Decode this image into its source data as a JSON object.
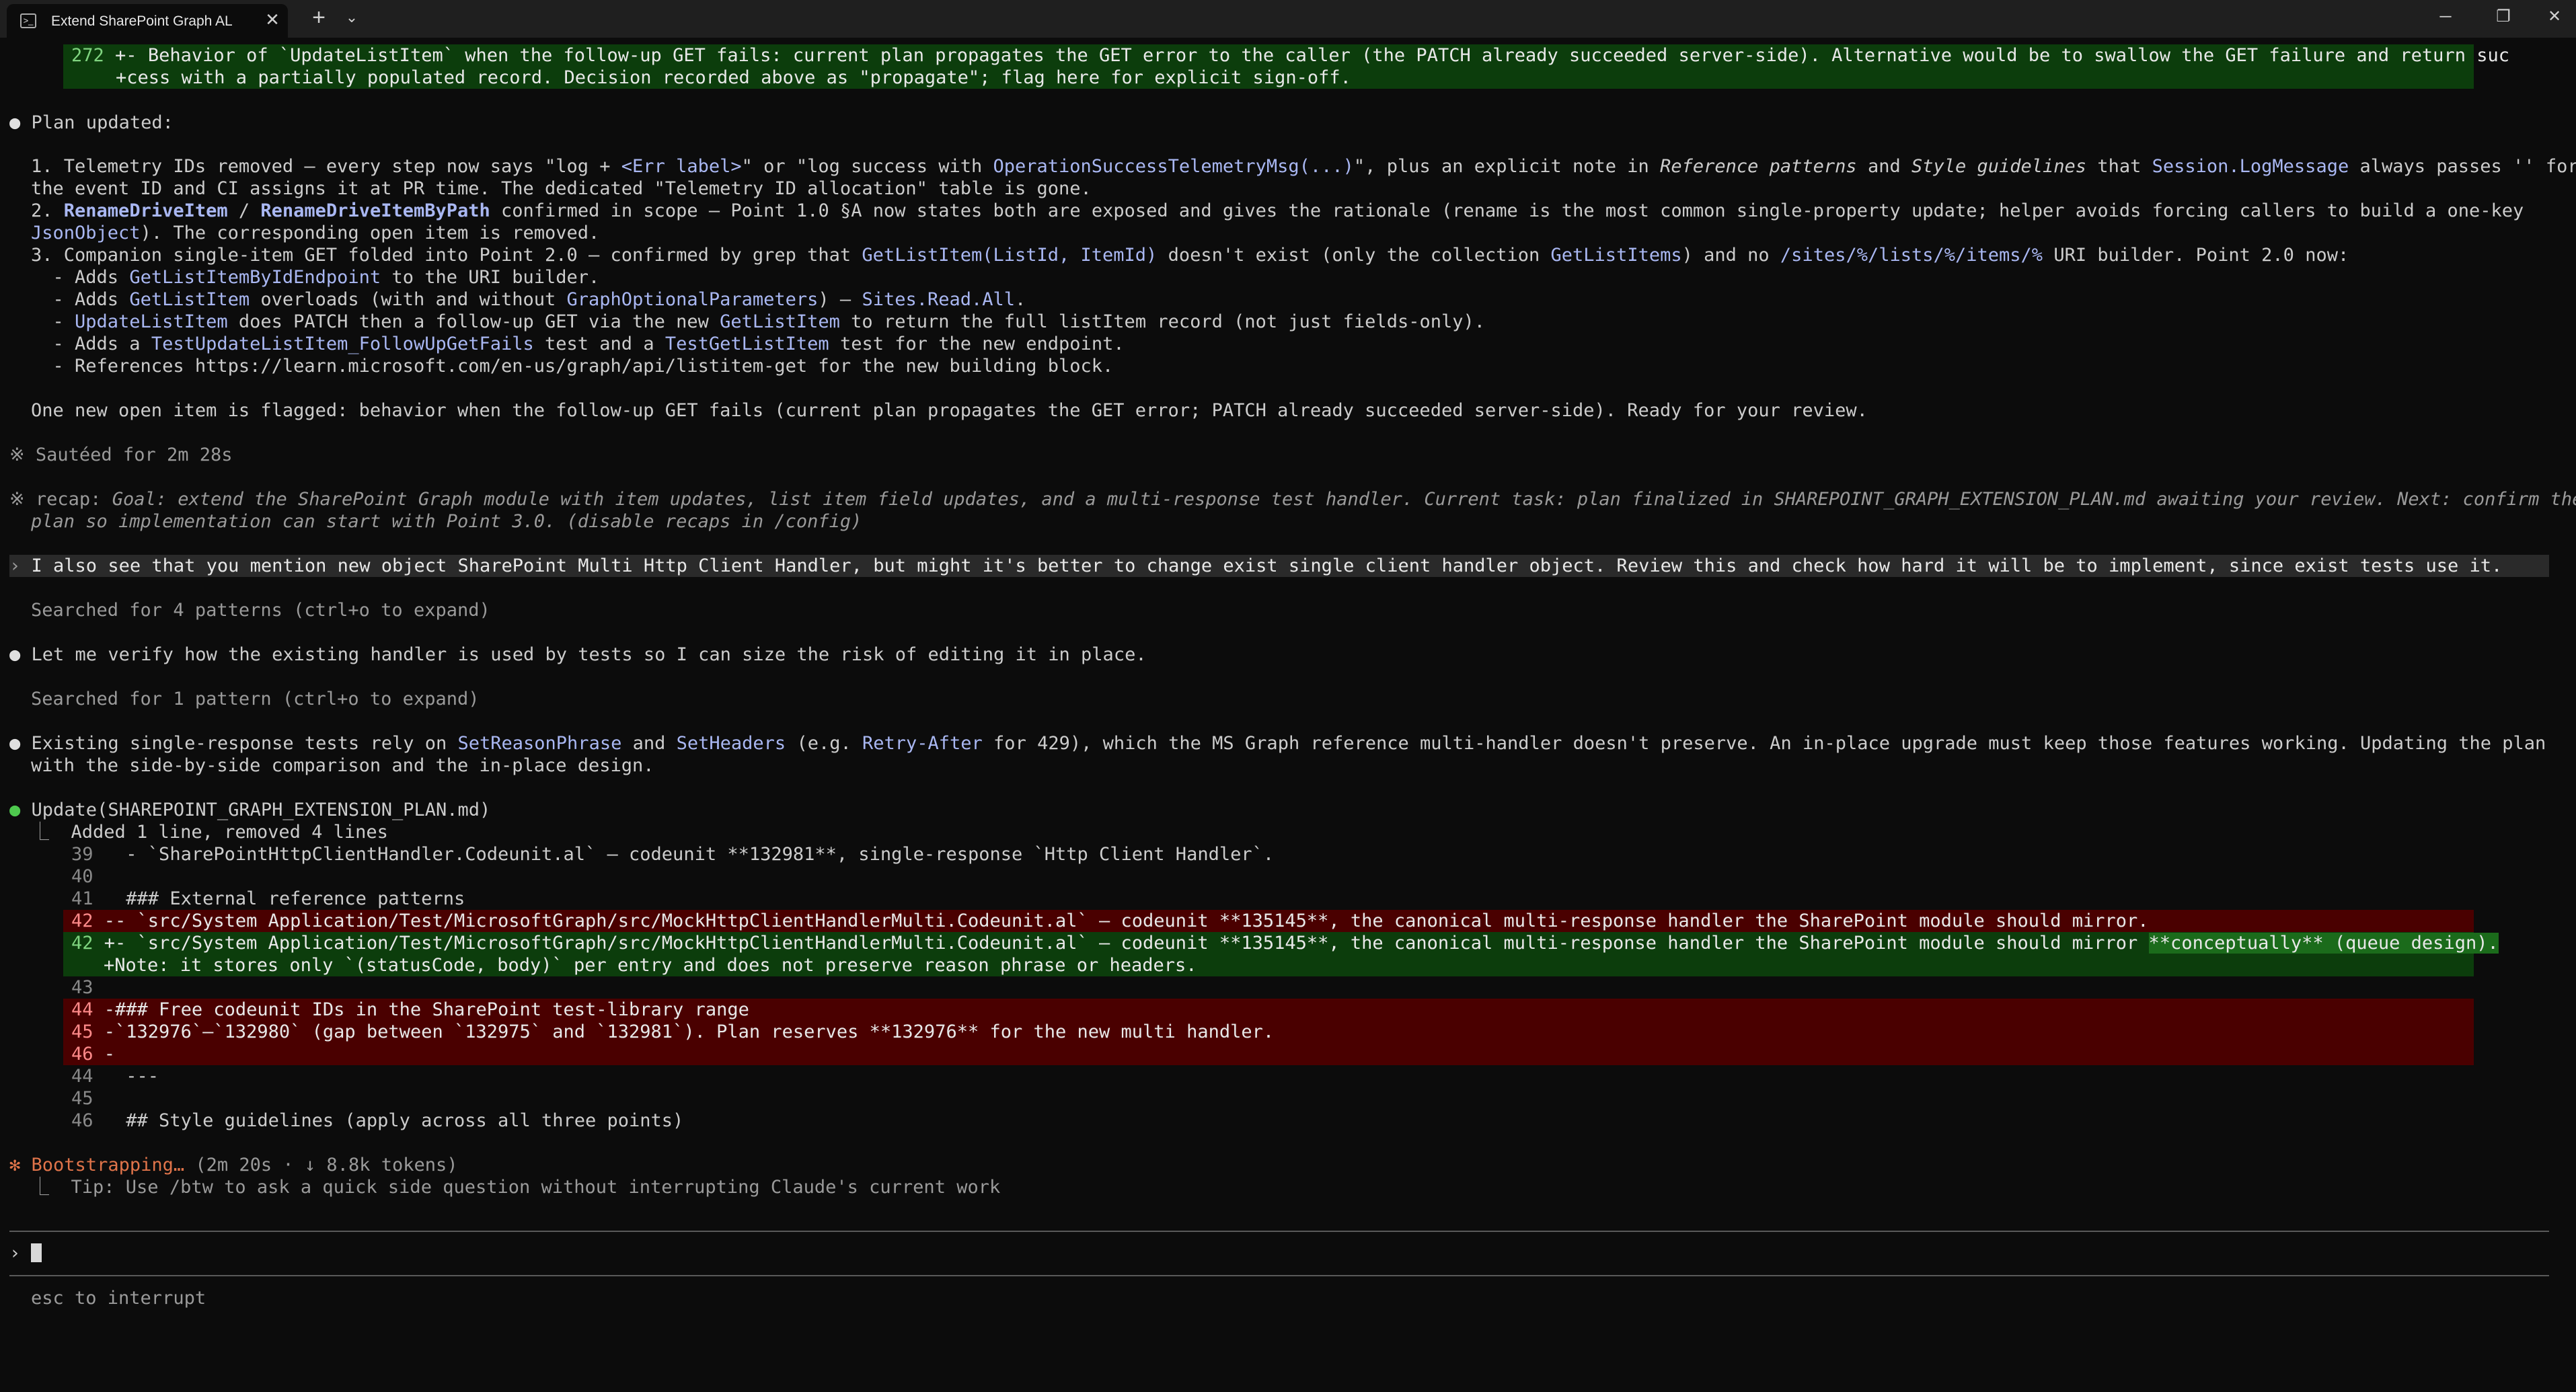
{
  "window": {
    "tab_title": "Extend SharePoint Graph AL",
    "tab_icon": "terminal-icon",
    "tab_close": "✕",
    "new_tab": "+",
    "tab_menu": "⌄",
    "minimize": "─",
    "maximize": "❐",
    "close": "✕"
  },
  "top_diff": {
    "line_no": "272",
    "l1": "+- Behavior of `UpdateListItem` when the follow-up GET fails: current plan propagates the GET error to the caller (the PATCH already succeeded server-side). Alternative would be to swallow the GET failure and return suc",
    "l2": "+cess with a partially populated record. Decision recorded above as \"propagate\"; flag here for explicit sign-off."
  },
  "plan_updated": {
    "bullet": "●",
    "title": "Plan updated:",
    "i1": {
      "a": "1. Telemetry IDs removed — every step now says \"log + ",
      "b": "<Err label>",
      "c": "\" or \"log success with ",
      "d": "OperationSuccessTelemetryMsg(...)",
      "e": "\", plus an explicit note in ",
      "f": "Reference patterns",
      "g": " and ",
      "h": "Style guidelines",
      "i": " that ",
      "j": "Session.LogMessage",
      "k": " always passes '' for",
      "l2": "the event ID and CI assigns it at PR time. The dedicated \"Telemetry ID allocation\" table is gone."
    },
    "i2": {
      "a": "2. ",
      "b": "RenameDriveItem",
      "c": " / ",
      "d": "RenameDriveItemByPath",
      "e": " confirmed in scope — Point 1.0 §A now states both are exposed and gives the rationale (rename is the most common single-property update; helper avoids forcing callers to build a one-key",
      "l2a": "JsonObject",
      "l2b": "). The corresponding open item is removed."
    },
    "i3": {
      "a": "3. Companion single-item GET folded into Point 2.0 — confirmed by grep that ",
      "b": "GetListItem(ListId, ItemId)",
      "c": " doesn't exist (only the collection ",
      "d": "GetListItems",
      "e": ") and no ",
      "f": "/sites/%/lists/%/items/%",
      "g": " URI builder. Point 2.0 now:"
    },
    "s1": {
      "a": "  - Adds ",
      "b": "GetListItemByIdEndpoint",
      "c": " to the URI builder."
    },
    "s2": {
      "a": "  - Adds ",
      "b": "GetListItem",
      "c": " overloads (with and without ",
      "d": "GraphOptionalParameters",
      "e": ") — ",
      "f": "Sites.Read.All",
      "g": "."
    },
    "s3": {
      "a": "  - ",
      "b": "UpdateListItem",
      "c": " does PATCH then a follow-up GET via the new ",
      "d": "GetListItem",
      "e": " to return the full listItem record (not just fields-only)."
    },
    "s4": {
      "a": "  - Adds a ",
      "b": "TestUpdateListItem_FollowUpGetFails",
      "c": " test and a ",
      "d": "TestGetListItem",
      "e": " test for the new endpoint."
    },
    "s5": "  - References https://learn.microsoft.com/en-us/graph/api/listitem-get for the new building block."
  },
  "open_item": "One new open item is flagged: behavior when the follow-up GET fails (current plan propagates the GET error; PATCH already succeeded server-side). Ready for your review.",
  "sauteed": {
    "icon": "※",
    "text": "Sautéed for 2m 28s"
  },
  "recap": {
    "icon": "※",
    "label": "recap:",
    "l1": " Goal: extend the SharePoint Graph module with item updates, list item field updates, and a multi-response test handler. Current task: plan finalized in SHAREPOINT_GRAPH_EXTENSION_PLAN.md awaiting your review. Next: confirm the",
    "l2": "plan so implementation can start with Point 3.0. (disable recaps in /config)"
  },
  "user_msg": {
    "prompt": "›",
    "text": "I also see that you mention new object SharePoint Multi Http Client Handler, but might it's better to change exist single client handler object. Review this and check how hard it will be to implement, since exist tests use it."
  },
  "search1": "Searched for 4 patterns (ctrl+o to expand)",
  "verify": {
    "bullet": "●",
    "text": "Let me verify how the existing handler is used by tests so I can size the risk of editing it in place."
  },
  "search2": "Searched for 1 pattern (ctrl+o to expand)",
  "existing": {
    "bullet": "●",
    "a": "Existing single-response tests rely on ",
    "b": "SetReasonPhrase",
    "c": " and ",
    "d": "SetHeaders",
    "e": " (e.g. ",
    "f": "Retry-After",
    "g": " for 429), which the MS Graph reference multi-handler doesn't preserve. An in-place upgrade must keep those features working. Updating the plan",
    "l2": "with the side-by-side comparison and the in-place design."
  },
  "update": {
    "bullet": "●",
    "title": "Update(SHAREPOINT_GRAPH_EXTENSION_PLAN.md)",
    "corner": "⎿",
    "summary": "Added 1 line, removed 4 lines"
  },
  "diff": {
    "d39": {
      "n": "39",
      "t": "  - `SharePointHttpClientHandler.Codeunit.al` — codeunit **132981**, single-response `Http Client Handler`."
    },
    "d40": {
      "n": "40",
      "t": ""
    },
    "d41": {
      "n": "41",
      "t": "  ### External reference patterns"
    },
    "d42r": {
      "n": "42",
      "t": "-- `src/System Application/Test/MicrosoftGraph/src/MockHttpClientHandlerMulti.Codeunit.al` — codeunit **135145**, the canonical multi-response handler the SharePoint module should mirror."
    },
    "d42a": {
      "n": "42",
      "a": "+- `src/System Application/Test/MicrosoftGraph/src/MockHttpClientHandlerMulti.Codeunit.al` — codeunit **135145**, the canonical multi-response handler the SharePoint module should mirror ",
      "b": "**conceptually** (queue design).",
      "l2": "+Note: it stores only `(statusCode, body)` per entry and does not preserve reason phrase or headers."
    },
    "d43": {
      "n": "43",
      "t": ""
    },
    "d44r": {
      "n": "44",
      "t": "-### Free codeunit IDs in the SharePoint test-library range"
    },
    "d45r": {
      "n": "45",
      "t": "-`132976`–`132980` (gap between `132975` and `132981`). Plan reserves **132976** for the new multi handler."
    },
    "d46r": {
      "n": "46",
      "t": "-"
    },
    "d44": {
      "n": "44",
      "t": "  ---"
    },
    "d45": {
      "n": "45",
      "t": ""
    },
    "d46": {
      "n": "46",
      "t": "  ## Style guidelines (apply across all three points)"
    }
  },
  "status": {
    "icon": "✻",
    "label": "Bootstrapping…",
    "meta": " (2m 20s · ↓ 8.8k tokens)",
    "corner": "⎿",
    "tip": "Tip: Use /btw to ask a quick side question without interrupting Claude's current work"
  },
  "input": {
    "prompt": "›",
    "value": ""
  },
  "footer": "esc to interrupt"
}
